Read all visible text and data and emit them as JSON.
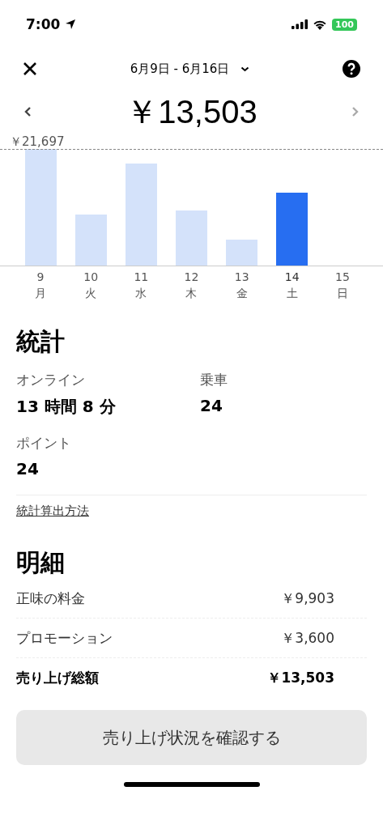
{
  "status_bar": {
    "time": "7:00",
    "battery": "100"
  },
  "header": {
    "date_range": "6月9日 - 6月16日",
    "total": "￥13,503"
  },
  "chart": {
    "max_label": "￥21,697",
    "days": [
      {
        "date": "9",
        "weekday": "月",
        "selected": false
      },
      {
        "date": "10",
        "weekday": "火",
        "selected": false
      },
      {
        "date": "11",
        "weekday": "水",
        "selected": false
      },
      {
        "date": "12",
        "weekday": "木",
        "selected": false
      },
      {
        "date": "13",
        "weekday": "金",
        "selected": false
      },
      {
        "date": "14",
        "weekday": "土",
        "selected": true
      },
      {
        "date": "15",
        "weekday": "日",
        "selected": false
      }
    ]
  },
  "stats": {
    "title": "統計",
    "items": [
      {
        "label": "オンライン",
        "value": "13 時間 8 分"
      },
      {
        "label": "乗車",
        "value": "24"
      },
      {
        "label": "ポイント",
        "value": "24"
      }
    ],
    "link": "統計算出方法"
  },
  "breakdown": {
    "title": "明細",
    "rows": [
      {
        "label": "正味の料金",
        "amount": "￥9,903",
        "kind": "item"
      },
      {
        "label": "プロモーション",
        "amount": "￥3,600",
        "kind": "item"
      },
      {
        "label": "売り上げ総額",
        "amount": "￥13,503",
        "kind": "total"
      }
    ]
  },
  "button": "売り上げ状況を確認する"
}
